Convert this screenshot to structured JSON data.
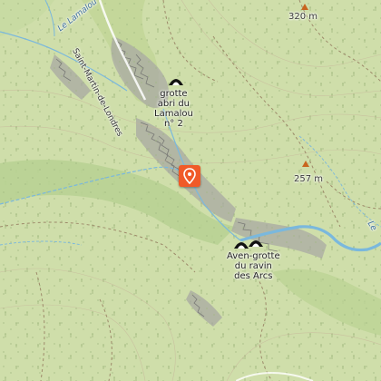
{
  "colors": {
    "land": "#cfdeaa",
    "forest_dark": "#b5cf92",
    "rock": "#9a9a9a",
    "water": "#6fb7e0",
    "marker": "#f05a28"
  },
  "labels": {
    "lamalou_stream": "Le Lamalou",
    "road": "Saint-Martin-de-Londres",
    "cave1_line1": "grotte",
    "cave1_line2": "abri du",
    "cave1_line3": "Lamalou",
    "cave1_line4": "n° 2",
    "cave2_line1": "Aven-grotte",
    "cave2_line2": "du ravin",
    "cave2_line3": "des Arcs",
    "peak1": "320 m",
    "peak2": "257 m",
    "river_edge": "Le"
  },
  "icons": {
    "marker": "location-pin-icon",
    "cave": "cave-icon",
    "peak": "peak-triangle-icon"
  }
}
